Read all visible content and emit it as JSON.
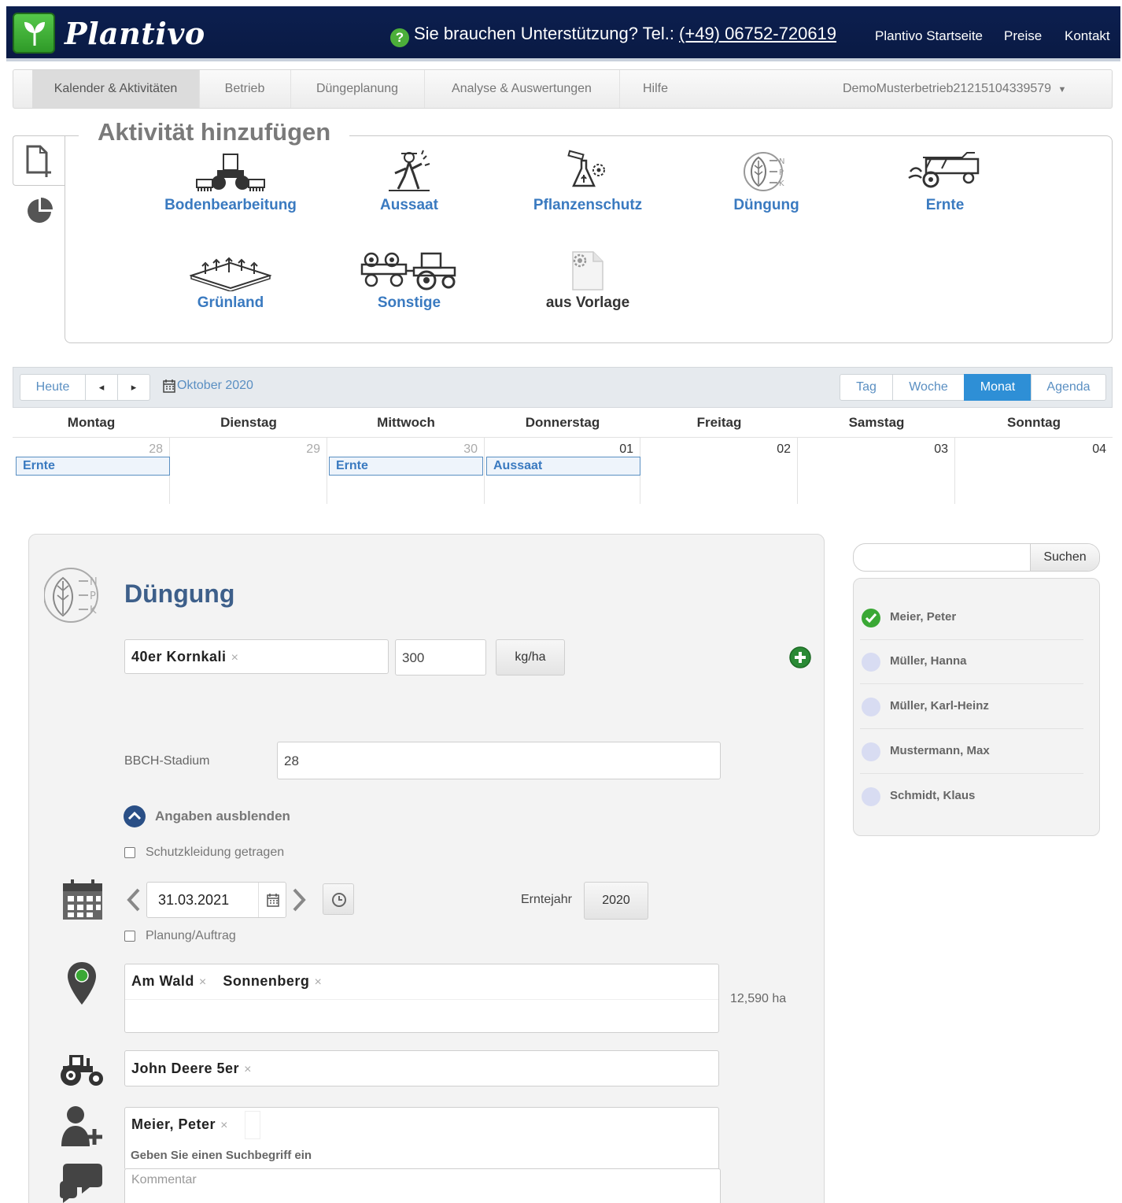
{
  "header": {
    "brand": "Plantivo",
    "support_text": "Sie brauchen Unterstützung? Tel.:",
    "phone": "(+49) 06752-720619",
    "links": [
      "Plantivo Startseite",
      "Preise",
      "Kontakt"
    ]
  },
  "subnav": {
    "tabs": [
      "Kalender & Aktivitäten",
      "Betrieb",
      "Düngeplanung",
      "Analyse & Auswertungen",
      "Hilfe"
    ],
    "active": "Kalender & Aktivitäten",
    "tenant": "DemoMusterbetrieb21215104339579"
  },
  "activity_panel": {
    "title": "Aktivität hinzufügen",
    "activities": [
      "Bodenbearbeitung",
      "Aussaat",
      "Pflanzenschutz",
      "Düngung",
      "Ernte",
      "Grünland",
      "Sonstige",
      "aus Vorlage"
    ]
  },
  "calendar": {
    "today": "Heute",
    "prev": "◂",
    "next": "▸",
    "month": "Oktober 2020",
    "views": [
      "Tag",
      "Woche",
      "Monat",
      "Agenda"
    ],
    "active_view": "Monat",
    "weekdays": [
      "Montag",
      "Dienstag",
      "Mittwoch",
      "Donnerstag",
      "Freitag",
      "Samstag",
      "Sonntag"
    ],
    "days": [
      "28",
      "29",
      "30",
      "01",
      "02",
      "03",
      "04"
    ],
    "events": [
      {
        "day": "28",
        "label": "Ernte"
      },
      {
        "day": "30",
        "label": "Ernte"
      },
      {
        "day": "01",
        "label": "Aussaat"
      }
    ]
  },
  "form": {
    "title": "Düngung",
    "fertilizer": "40er Kornkali",
    "amount": "300",
    "unit": "kg/ha",
    "bbch_label": "BBCH-Stadium",
    "bbch_value": "28",
    "toggle_details": "Angaben ausblenden",
    "protective_clothing": "Schutzkleidung getragen",
    "date": "31.03.2021",
    "harvest_year_label": "Erntejahr",
    "harvest_year": "2020",
    "planning": "Planung/Auftrag",
    "fields": [
      "Am Wald",
      "Sonnenberg"
    ],
    "area": "12,590 ha",
    "machine": "John Deere 5er",
    "person": "Meier, Peter",
    "person_placeholder": "Geben Sie einen Suchbegriff ein",
    "comment_placeholder": "Kommentar"
  },
  "search": {
    "button": "Suchen",
    "value": ""
  },
  "people": [
    {
      "name": "Meier, Peter",
      "selected": true
    },
    {
      "name": "Müller, Hanna",
      "selected": false
    },
    {
      "name": "Müller, Karl-Heinz",
      "selected": false
    },
    {
      "name": "Mustermann, Max",
      "selected": false
    },
    {
      "name": "Schmidt, Klaus",
      "selected": false
    }
  ],
  "colors": {
    "header_bg": "#0c1f4f",
    "link_blue": "#3a7ac0",
    "active_view": "#2e8fd6",
    "form_title": "#3d5f8a"
  }
}
